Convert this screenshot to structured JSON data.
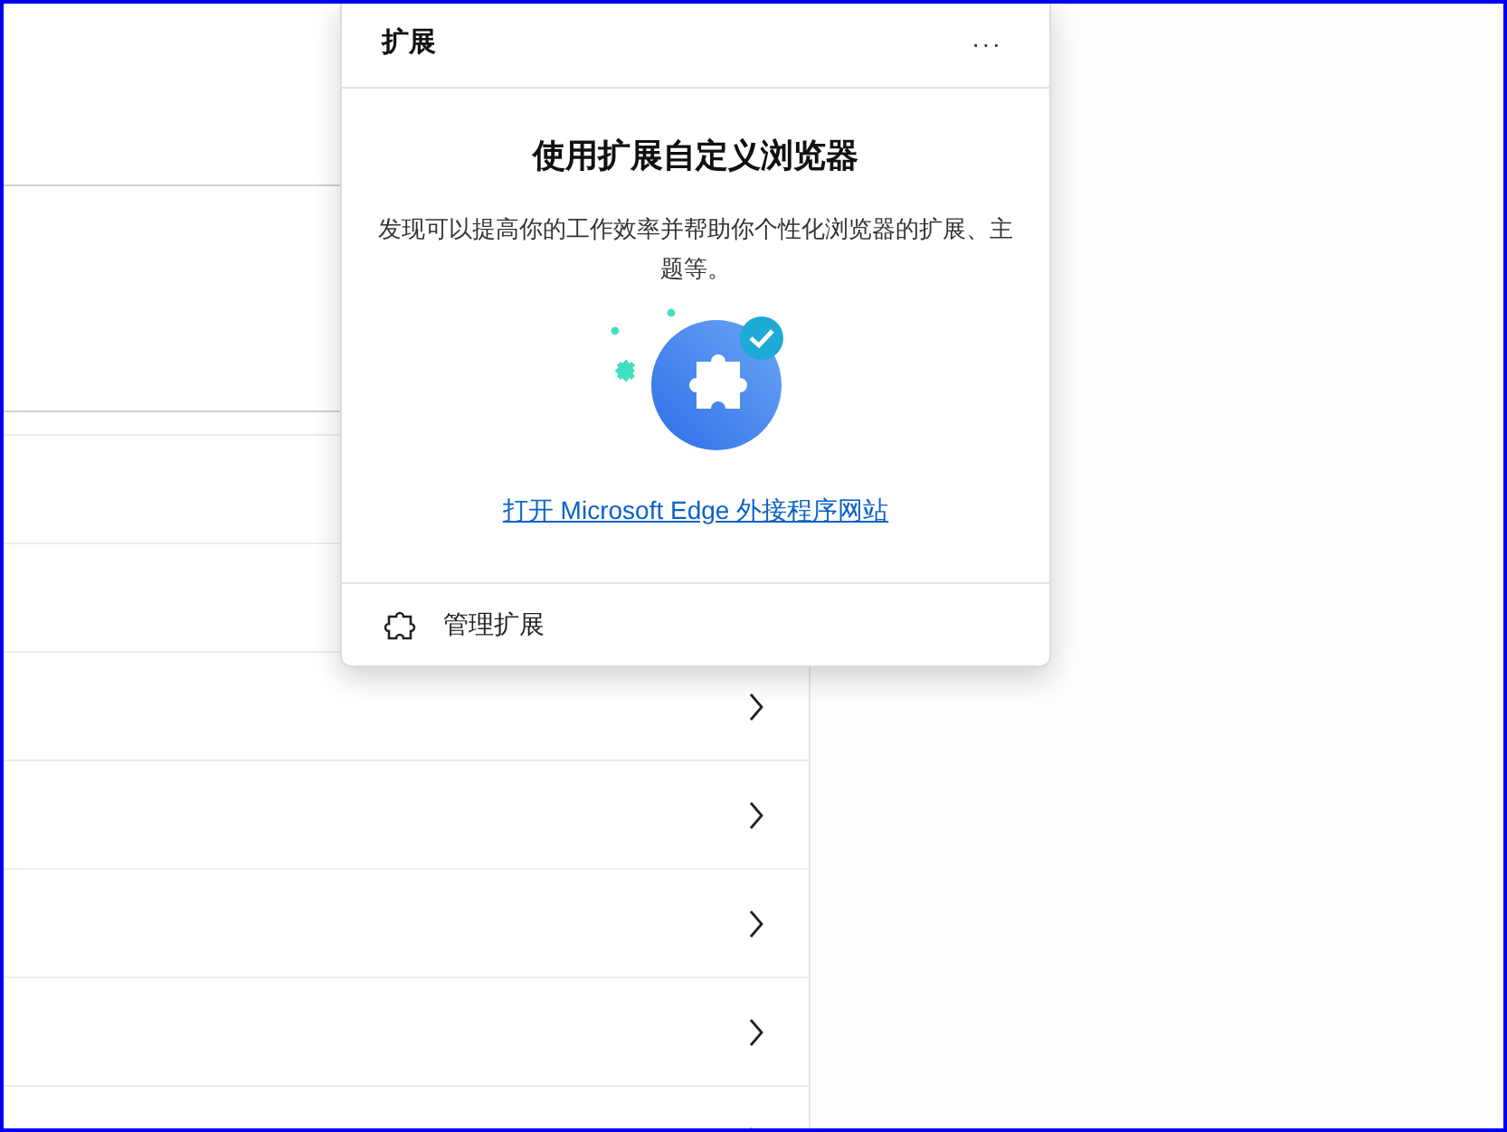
{
  "popup": {
    "title": "扩展",
    "more": "···",
    "heading": "使用扩展自定义浏览器",
    "description": "发现可以提高你的工作效率并帮助你个性化浏览器的扩展、主题等。",
    "link": "打开 Microsoft Edge 外接程序网站",
    "footer_item": "管理扩展"
  }
}
